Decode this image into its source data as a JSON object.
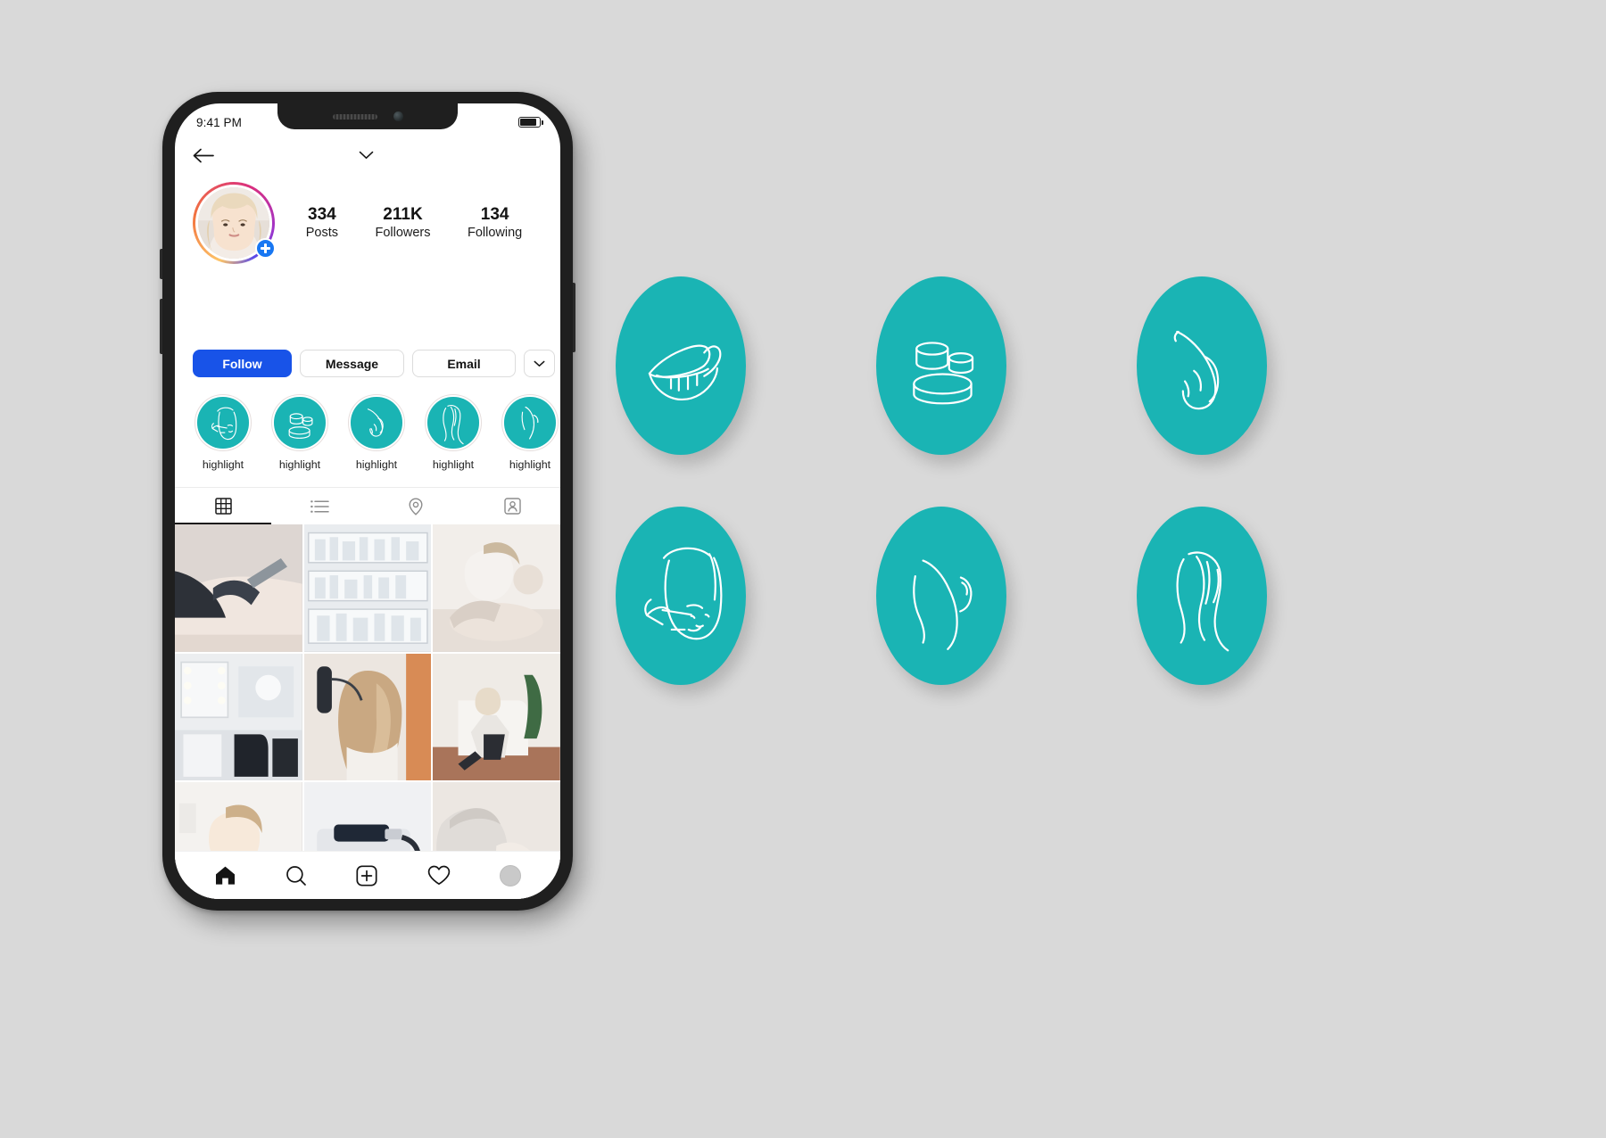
{
  "theme": {
    "brand_teal": "#1ab4b4",
    "follow_blue": "#1853e8",
    "badge_blue": "#1877f2",
    "page_background": "#d9d9d9",
    "screen_background": "#ffffff"
  },
  "phone": {
    "status_bar": {
      "time": "9:41 PM",
      "battery_icon": "battery-icon"
    },
    "top_bar": {
      "back_icon": "back-arrow-icon",
      "dropdown_icon": "chevron-down-icon",
      "menu_icon": "hamburger-menu-icon"
    },
    "profile": {
      "avatar_name": "profile-avatar",
      "story_ring": "instagram-gradient-ring",
      "add_story_badge": "plus-badge-icon",
      "stats": [
        {
          "value": "334",
          "label": "Posts"
        },
        {
          "value": "211K",
          "label": "Followers"
        },
        {
          "value": "134",
          "label": "Following"
        }
      ]
    },
    "actions": {
      "follow_label": "Follow",
      "message_label": "Message",
      "email_label": "Email",
      "more_icon": "chevron-down-icon"
    },
    "highlights": [
      {
        "label": "highlight",
        "icon": "eyebrow-threading-icon"
      },
      {
        "label": "highlight",
        "icon": "cosmetic-jars-icon"
      },
      {
        "label": "highlight",
        "icon": "hand-icon"
      },
      {
        "label": "highlight",
        "icon": "long-hair-woman-icon"
      },
      {
        "label": "highlight",
        "icon": "body-silhouette-icon"
      }
    ],
    "tabs": [
      {
        "name": "grid",
        "icon": "grid-icon",
        "active": true
      },
      {
        "name": "list",
        "icon": "list-icon",
        "active": false
      },
      {
        "name": "places",
        "icon": "location-pin-icon",
        "active": false
      },
      {
        "name": "tagged",
        "icon": "tagged-person-icon",
        "active": false
      }
    ],
    "grid_posts": [
      {
        "alt": "cosmetic-procedure-closeup"
      },
      {
        "alt": "product-shelves"
      },
      {
        "alt": "facial-treatment"
      },
      {
        "alt": "salon-interior"
      },
      {
        "alt": "hair-styling"
      },
      {
        "alt": "client-seated-portrait"
      },
      {
        "alt": "woman-in-white"
      },
      {
        "alt": "device-tool"
      },
      {
        "alt": "beauty-treatment"
      }
    ],
    "bottom_nav": [
      {
        "name": "home",
        "icon": "home-icon",
        "active": true
      },
      {
        "name": "search",
        "icon": "search-icon",
        "active": false
      },
      {
        "name": "create",
        "icon": "plus-square-icon",
        "active": false
      },
      {
        "name": "activity",
        "icon": "heart-icon",
        "active": false
      },
      {
        "name": "profile",
        "icon": "profile-avatar-icon",
        "active": false
      }
    ]
  },
  "icon_board": {
    "rows": [
      [
        {
          "icon": "lips-icon",
          "label": "lips"
        },
        {
          "icon": "cosmetic-jars-icon",
          "label": "cosmetic jars"
        },
        {
          "icon": "hand-icon",
          "label": "hand"
        }
      ],
      [
        {
          "icon": "eyebrow-threading-face-icon",
          "label": "eyebrow threading face"
        },
        {
          "icon": "body-back-icon",
          "label": "body back"
        },
        {
          "icon": "long-hair-woman-icon",
          "label": "long hair woman"
        }
      ]
    ]
  }
}
